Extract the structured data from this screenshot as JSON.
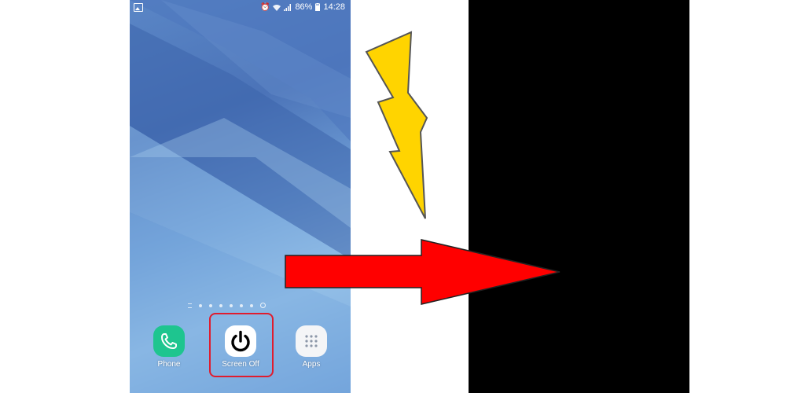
{
  "status_bar": {
    "battery": "86%",
    "time": "14:28",
    "icons": [
      "gallery-icon",
      "alarm-icon",
      "wifi-icon",
      "signal-icon",
      "battery-icon"
    ]
  },
  "page_indicator": {
    "pages": 7,
    "current": "home"
  },
  "dock": {
    "apps": [
      {
        "label": "Phone",
        "icon": "phone-handset-icon",
        "color": "#1ec58f"
      },
      {
        "label": "Screen Off",
        "icon": "power-icon",
        "color": "#ffffff"
      },
      {
        "label": "Apps",
        "icon": "app-grid-icon",
        "color": "#f4f5f7"
      }
    ]
  },
  "highlight_color": "#e01c2e",
  "arrow_color": "#ff0000",
  "lightning_color": "#ffd400",
  "screen_off_color": "#000000"
}
